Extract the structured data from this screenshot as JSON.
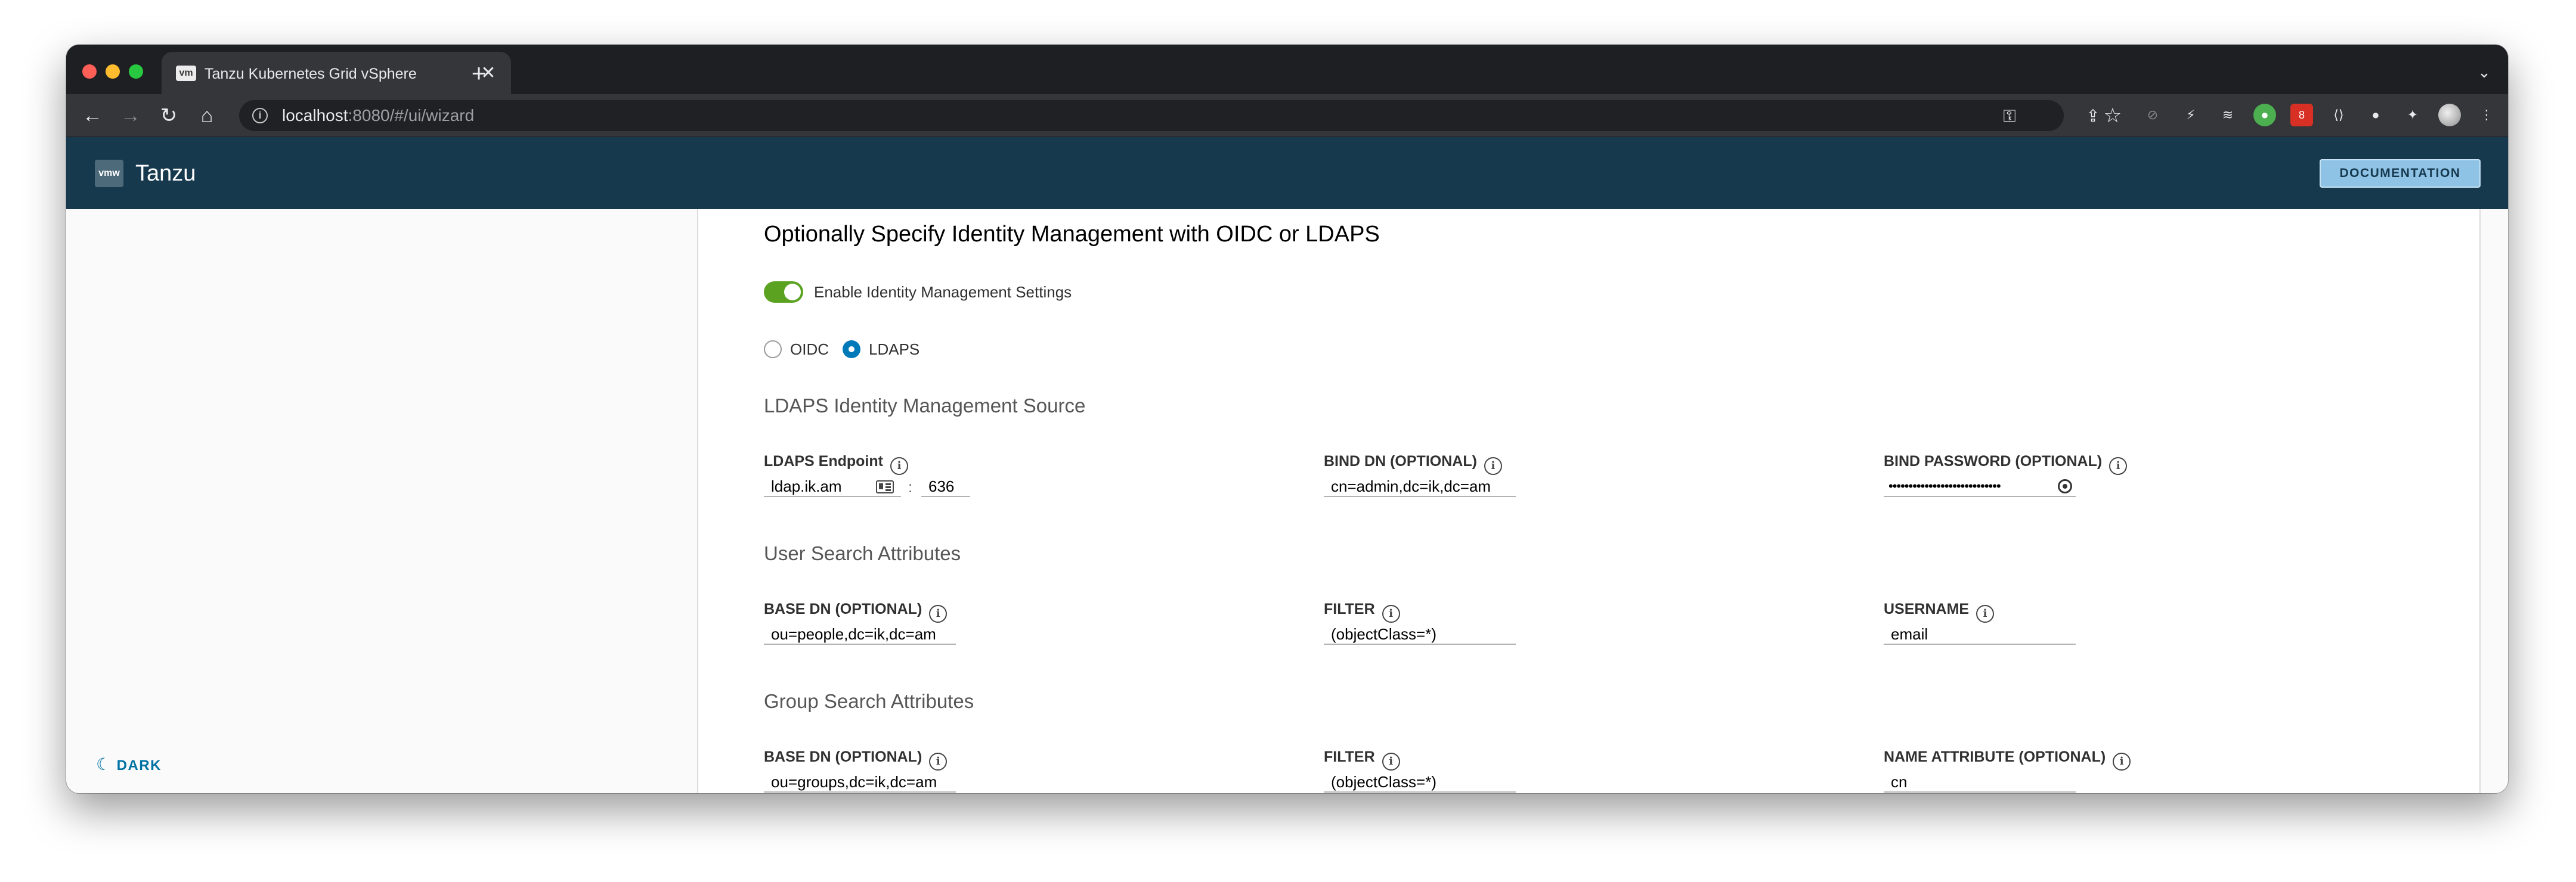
{
  "browser": {
    "tab_title": "Tanzu Kubernetes Grid vSphere",
    "tab_favicon": "vm",
    "url_host": "localhost",
    "url_rest": ":8080/#/ui/wizard",
    "extension_badge": "8"
  },
  "app": {
    "brand_logo": "vmw",
    "brand_name": "Tanzu",
    "documentation_label": "DOCUMENTATION",
    "dark_label": "DARK"
  },
  "form": {
    "title": "Optionally Specify Identity Management with OIDC or LDAPS",
    "enable_toggle_label": "Enable Identity Management Settings",
    "enable_toggle_on": true,
    "radio_oidc": "OIDC",
    "radio_ldaps": "LDAPS",
    "selected_provider": "LDAPS",
    "ldaps_section": "LDAPS Identity Management Source",
    "ldaps_endpoint_label": "LDAPS Endpoint",
    "ldaps_host": "ldap.ik.am",
    "ldaps_port": "636",
    "bind_dn_label": "BIND DN (OPTIONAL)",
    "bind_dn": "cn=admin,dc=ik,dc=am",
    "bind_password_label": "BIND PASSWORD (OPTIONAL)",
    "bind_password_mask": "••••••••••••••••••••••••••••",
    "user_section": "User Search Attributes",
    "user_base_dn_label": "BASE DN (OPTIONAL)",
    "user_base_dn": "ou=people,dc=ik,dc=am",
    "user_filter_label": "FILTER",
    "user_filter": "(objectClass=*)",
    "username_label": "USERNAME",
    "username": "email",
    "group_section": "Group Search Attributes",
    "group_base_dn_label": "BASE DN (OPTIONAL)",
    "group_base_dn": "ou=groups,dc=ik,dc=am",
    "group_filter_label": "FILTER",
    "group_filter": "(objectClass=*)",
    "name_attribute_label": "NAME ATTRIBUTE (OPTIONAL)",
    "name_attribute": "cn"
  },
  "icons": [
    "back-icon",
    "forward-icon",
    "reload-icon",
    "home-icon",
    "site-info-icon",
    "key-icon",
    "share-icon",
    "star-icon",
    "extensions-icon",
    "info-icon",
    "eye-icon",
    "moon-icon"
  ],
  "colors": {
    "header_bg": "#17394e",
    "accent": "#0079b8",
    "toggle_on": "#5aa220",
    "doc_button": "#8fc3e6"
  }
}
